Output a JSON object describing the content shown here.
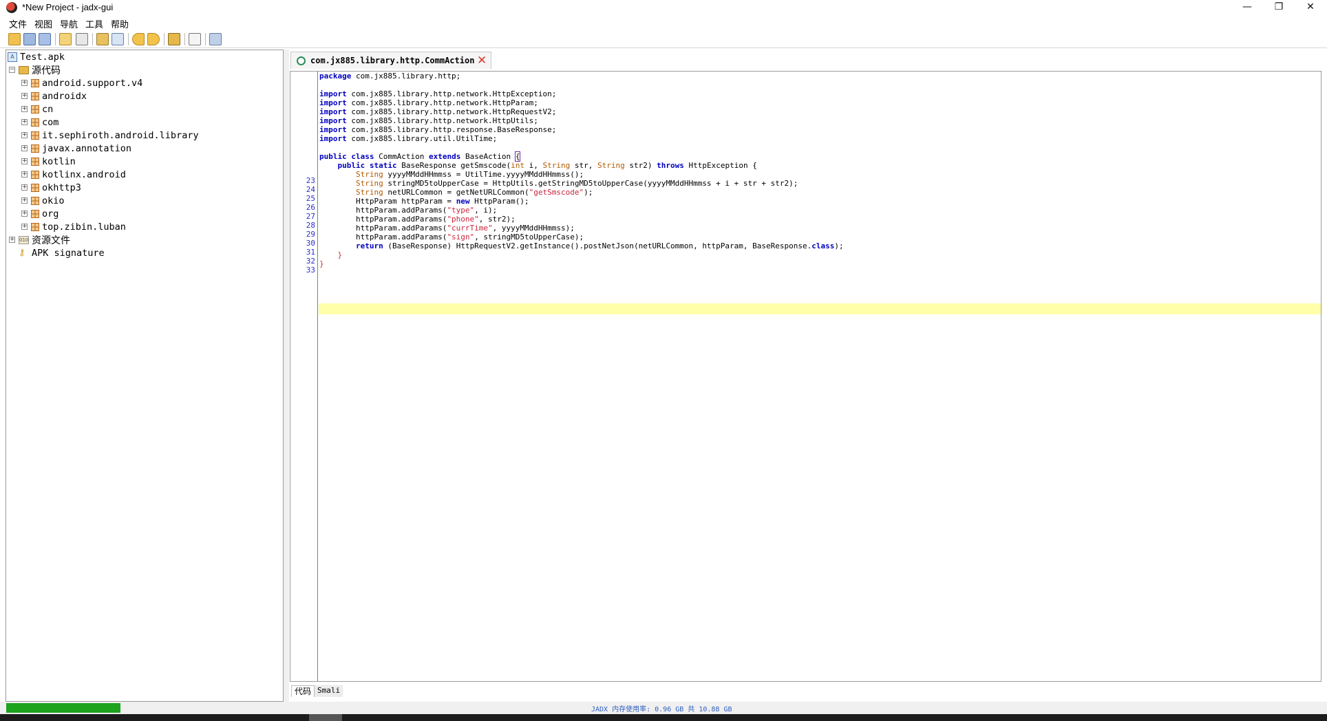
{
  "window": {
    "title": "*New Project - jadx-gui",
    "minimize": "—",
    "maximize": "❐",
    "close": "✕"
  },
  "menu": {
    "items": [
      "文件",
      "视图",
      "导航",
      "工具",
      "帮助"
    ]
  },
  "toolbar": {
    "buttons": [
      "open-icon",
      "add-files-icon",
      "save-all-icon",
      "sync-icon",
      "flatten-icon",
      "search-icon",
      "find-icon",
      "back-icon",
      "forward-icon",
      "decompile-icon",
      "log-icon",
      "preferences-icon"
    ]
  },
  "tree": {
    "root": "Test.apk",
    "source_folder": "源代码",
    "packages": [
      "android.support.v4",
      "androidx",
      "cn",
      "com",
      "it.sephiroth.android.library",
      "javax.annotation",
      "kotlin",
      "kotlinx.android",
      "okhttp3",
      "okio",
      "org",
      "top.zibin.luban"
    ],
    "resources": "资源文件",
    "signature": "APK signature"
  },
  "editor": {
    "tab_title": "com.jx885.library.http.CommAction",
    "tab_close": "✕",
    "line_numbers": [
      "23",
      "24",
      "25",
      "26",
      "27",
      "28",
      "29",
      "30",
      "31",
      "32",
      "33"
    ],
    "code": {
      "pkg_kw": "package",
      "pkg_name": " com.jx885.library.http;",
      "imports": [
        "com.jx885.library.http.network.HttpException;",
        "com.jx885.library.http.network.HttpParam;",
        "com.jx885.library.http.network.HttpRequestV2;",
        "com.jx885.library.http.network.HttpUtils;",
        "com.jx885.library.http.response.BaseResponse;",
        "com.jx885.library.util.UtilTime;"
      ],
      "import_kw": "import",
      "strings": [
        "\"getSmscode\"",
        "\"type\"",
        "\"phone\"",
        "\"currTime\"",
        "\"sign\""
      ]
    },
    "bottom_tabs": [
      "代码",
      "Smali"
    ]
  },
  "status": {
    "memory": "JADX 内存使用率: 0.96 GB 共 10.88 GB",
    "progress": 1.0
  },
  "colors": {
    "keyword": "#0000c0",
    "type": "#b05a00",
    "string": "#c8243c",
    "line_number": "#2d2dc8",
    "highlight": "#ffffaa",
    "progress": "#1ea31e"
  }
}
